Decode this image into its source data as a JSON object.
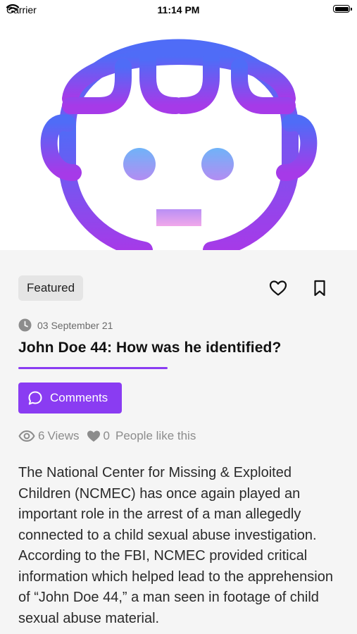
{
  "status_bar": {
    "carrier": "Carrier",
    "time": "11:14 PM"
  },
  "article": {
    "tag": "Featured",
    "date": "03 September 21",
    "title": "John Doe 44: How was he identified?",
    "comments_label": "Comments",
    "views_count": "6",
    "views_label": "Views",
    "likes_count": "0",
    "likes_label": "People like this",
    "body": "The National Center for Missing & Exploited Children (NCMEC) has once again played an important role in the arrest of a man allegedly connected to a child sexual abuse investigation. According to the FBI, NCMEC provided critical information which helped lead to the apprehension of “John Doe 44,” a man seen in footage of child sexual abuse material."
  },
  "icons": {
    "hero": "face-avatar-icon",
    "wifi": "wifi-icon",
    "battery": "battery-icon",
    "like": "heart-outline-icon",
    "bookmark": "bookmark-icon",
    "clock": "clock-icon",
    "comment": "comment-bubble-icon",
    "eye": "eye-icon",
    "liked": "heart-filled-icon"
  },
  "colors": {
    "accent": "#8a3cf2",
    "hero_gradient_start": "#4f6cf7",
    "hero_gradient_end": "#a63ae8"
  }
}
